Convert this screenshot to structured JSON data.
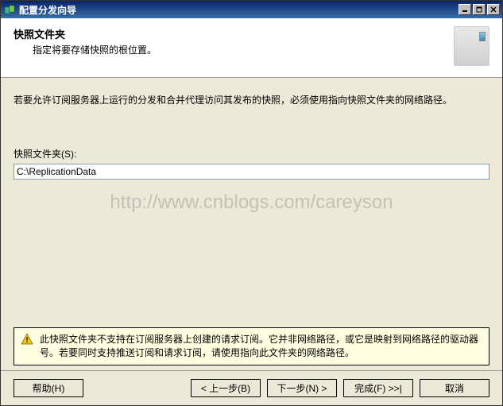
{
  "window": {
    "title": "配置分发向导",
    "minimize_tooltip": "Minimize",
    "maximize_tooltip": "Maximize",
    "close_tooltip": "Close"
  },
  "header": {
    "title": "快照文件夹",
    "subtitle": "指定将要存储快照的根位置。"
  },
  "content": {
    "instruction": "若要允许订阅服务器上运行的分发和合并代理访问其发布的快照，必须使用指向快照文件夹的网络路径。",
    "field_label": "快照文件夹(S):",
    "field_value": "C:\\ReplicationData"
  },
  "warning": {
    "text": "此快照文件夹不支持在订阅服务器上创建的请求订阅。它并非网络路径，或它是映射到网络路径的驱动器号。若要同时支持推送订阅和请求订阅，请使用指向此文件夹的网络路径。"
  },
  "buttons": {
    "help": "帮助(H)",
    "back": "< 上一步(B)",
    "next": "下一步(N) >",
    "finish": "完成(F) >>|",
    "cancel": "取消"
  },
  "watermark": "http://www.cnblogs.com/careyson"
}
